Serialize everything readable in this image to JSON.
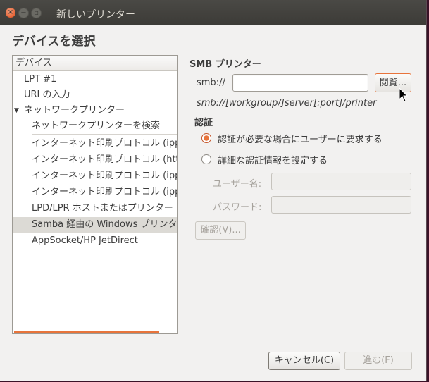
{
  "window": {
    "title": "新しいプリンター"
  },
  "heading": "デバイスを選択",
  "device_list": {
    "header": "デバイス",
    "items": [
      {
        "label": "LPT #1"
      },
      {
        "label": "URI の入力"
      },
      {
        "label": "ネットワークプリンター"
      },
      {
        "label": "ネットワークプリンターを検索"
      },
      {
        "label": "インターネット印刷プロトコル (ipp"
      },
      {
        "label": "インターネット印刷プロトコル (htt"
      },
      {
        "label": "インターネット印刷プロトコル (ipp"
      },
      {
        "label": "インターネット印刷プロトコル (ipp"
      },
      {
        "label": "LPD/LPR ホストまたはプリンター"
      },
      {
        "label": "Samba 経由の Windows プリンタ"
      },
      {
        "label": "AppSocket/HP JetDirect"
      }
    ],
    "selected": "Samba 経由の Windows プリンタ"
  },
  "smb": {
    "section_title": "SMB プリンター",
    "url_label": "smb://",
    "url_value": "",
    "browse_button": "閲覧...",
    "hint": "smb://[workgroup/]server[:port]/printer"
  },
  "auth": {
    "section_title": "認証",
    "option_prompt": "認証が必要な場合にユーザーに要求する",
    "option_details": "詳細な認証情報を設定する",
    "selected": "prompt",
    "username_label": "ユーザー名:",
    "password_label": "パスワード:",
    "username_value": "",
    "password_value": "",
    "verify_button": "確認(V)..."
  },
  "footer": {
    "cancel_button": "キャンセル(C)",
    "next_button": "進む(F)"
  },
  "colors": {
    "accent": "#e8743b",
    "titlebar": "#3c3b37",
    "window_bg": "#f2f1f0",
    "close_button": "#df4a16"
  }
}
